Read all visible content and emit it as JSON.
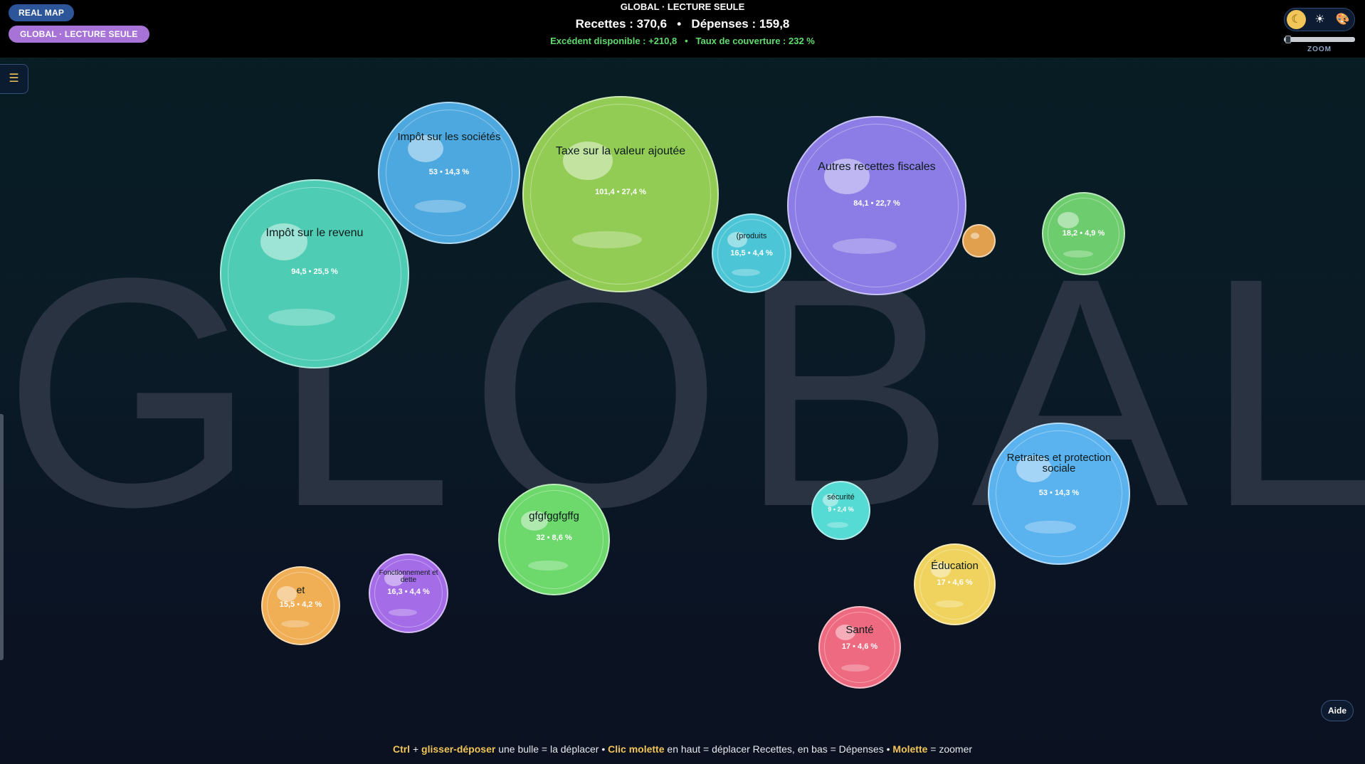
{
  "header": {
    "real_map_label": "REAL MAP",
    "global_label": "GLOBAL · LECTURE SEULE",
    "title": "GLOBAL · LECTURE SEULE",
    "recettes": "Recettes : 370,6",
    "separator": "•",
    "depenses": "Dépenses : 159,8",
    "excedent": "Excédent disponible : +210,8",
    "couverture": "Taux de couverture : 232 %"
  },
  "theme": {
    "dark_icon": "☾",
    "light_icon": "☀",
    "palette_icon": "🎨",
    "zoom_label": "ZOOM",
    "zoom_level": 0.02
  },
  "menu": {
    "icon": "☰"
  },
  "watermark": "GLOBAL",
  "bubbles": {
    "b1": {
      "label": "Impôt sur le revenu",
      "value": "94,5 • 25,5 %",
      "color": "#4ecdb4"
    },
    "b2": {
      "label": "Impôt sur les sociétés",
      "value": "53 • 14,3 %",
      "color": "#4ea8e0"
    },
    "b3": {
      "label": "Taxe sur la valeur ajoutée",
      "value": "101,4 • 27,4 %",
      "color": "#92cc54"
    },
    "b4": {
      "label": "(produits",
      "value": "16,5 • 4,4 %",
      "color": "#4cc6d6"
    },
    "b5": {
      "label": "Autres recettes fiscales",
      "value": "84,1 • 22,7 %",
      "color": "#8b7ce6"
    },
    "b6": {
      "label": "",
      "value": "",
      "color": "#e0a04e"
    },
    "b7": {
      "label": "",
      "value": "18,2 • 4,9 %",
      "color": "#6dcc6d"
    },
    "b8": {
      "label": "Retraites et protection sociale",
      "value": "53 • 14,3 %",
      "color": "#5ab2ef"
    },
    "b9": {
      "label": "sécurité",
      "value": "9 • 2,4 %",
      "color": "#56dbd4"
    },
    "b10": {
      "label": "Éducation",
      "value": "17 • 4,6 %",
      "color": "#f0d35e"
    },
    "b11": {
      "label": "Santé",
      "value": "17 • 4,6 %",
      "color": "#ee6a80"
    },
    "b12": {
      "label": "gfgfggfgffg",
      "value": "32 • 8,6 %",
      "color": "#6dd86b"
    },
    "b13": {
      "label": "Fonctionnement et dette",
      "value": "16,3 • 4,4 %",
      "color": "#a56ce8"
    },
    "b14": {
      "label": "et",
      "value": "15,5 • 4,2 %",
      "color": "#f0ae55"
    }
  },
  "help_label": "Aide",
  "footer": {
    "k1": "Ctrl",
    "t1": " + ",
    "k2": "glisser-déposer",
    "t2": " une bulle = la déplacer  •  ",
    "k3": "Clic molette",
    "t3": " en haut = déplacer Recettes, en bas = Dépenses  •  ",
    "k4": "Molette",
    "t4": " = zoomer"
  }
}
